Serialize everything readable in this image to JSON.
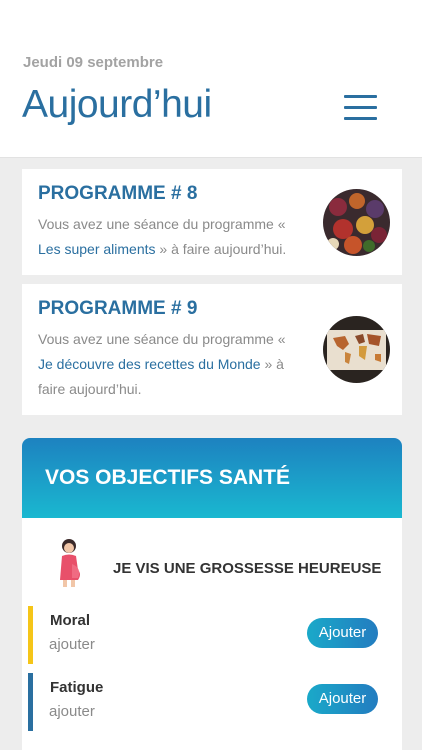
{
  "header": {
    "date": "Jeudi 09 septembre",
    "title": "Aujourd’hui"
  },
  "programs": [
    {
      "title": "PROGRAMME # 8",
      "text_before": "Vous avez une séance du programme « ",
      "link": "Les super aliments",
      "text_after": " » à faire aujourd’hui.",
      "image_icon": "superfoods-photo-icon"
    },
    {
      "title": "PROGRAMME # 9",
      "text_before": "Vous avez une séance du programme « ",
      "link": "Je découvre des recettes du Monde",
      "text_after": " » à faire aujourd’hui.",
      "image_icon": "world-map-food-photo-icon"
    }
  ],
  "goals": {
    "heading": "VOS OBJECTIFS SANTÉ",
    "goal_label": "JE VIS UNE GROSSESSE HEUREUSE",
    "goal_icon": "pregnant-woman-icon",
    "metrics": [
      {
        "name": "Moral",
        "sub": "ajouter",
        "button": "Ajouter",
        "color": "#f5c518"
      },
      {
        "name": "Fatigue",
        "sub": "ajouter",
        "button": "Ajouter",
        "color": "#2a6fa0"
      }
    ]
  },
  "colors": {
    "accent": "#2a6fa0",
    "header_gradient_top": "#1d82c0",
    "header_gradient_bottom": "#1ab8d0"
  }
}
